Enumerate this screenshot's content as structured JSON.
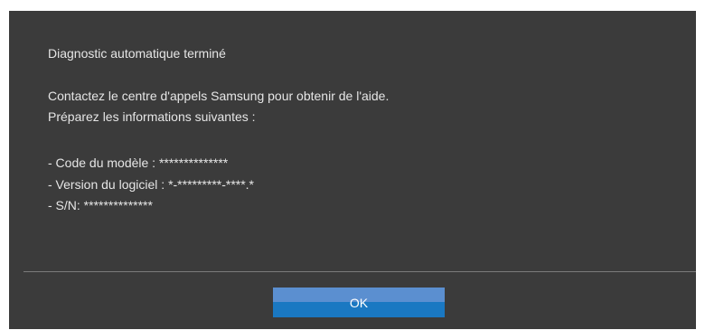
{
  "dialog": {
    "title": "Diagnostic automatique terminé",
    "contact_line": "Contactez le centre d'appels Samsung pour obtenir de l'aide.",
    "prepare_line": "Préparez les informations suivantes :",
    "model_code_line": "- Code du modèle : **************",
    "software_version_line": "- Version du logiciel : *-*********-****.*",
    "serial_line": "- S/N: **************"
  },
  "buttons": {
    "ok_label": "OK"
  },
  "colors": {
    "dialog_background": "#3b3b3b",
    "text": "#e6e6e6",
    "button_top": "#5b8fd0",
    "button_bottom": "#1a78c2"
  }
}
